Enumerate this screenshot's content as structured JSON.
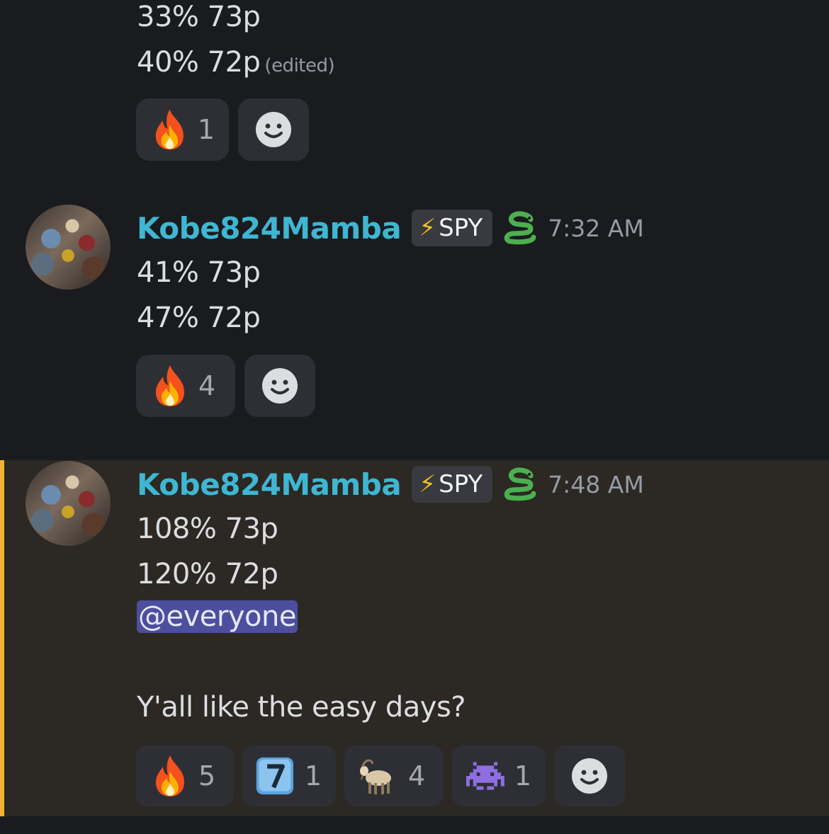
{
  "message1": {
    "lines": [
      "33% 73p",
      "40% 72p"
    ],
    "edited_label": "(edited)",
    "reactions": [
      {
        "emoji": "fire-icon",
        "count": "1"
      }
    ]
  },
  "message2": {
    "username": "Kobe824Mamba",
    "tag": {
      "icon": "lightning-icon",
      "label": "SPY"
    },
    "badge": "snake-icon",
    "timestamp": "7:32 AM",
    "lines": [
      "41% 73p",
      "47% 72p"
    ],
    "reactions": [
      {
        "emoji": "fire-icon",
        "count": "4"
      }
    ]
  },
  "message3": {
    "username": "Kobe824Mamba",
    "tag": {
      "icon": "lightning-icon",
      "label": "SPY"
    },
    "badge": "snake-icon",
    "timestamp": "7:48 AM",
    "lines": [
      "108% 73p",
      "120% 72p"
    ],
    "mention": "@everyone",
    "text": "Y'all like the easy days?",
    "highlight_color": "#f0b232",
    "reactions": [
      {
        "emoji": "fire-icon",
        "count": "5"
      },
      {
        "emoji": "keycap-seven-icon",
        "count": "1"
      },
      {
        "emoji": "goat-icon",
        "count": "4"
      },
      {
        "emoji": "space-invader-icon",
        "count": "1"
      }
    ]
  },
  "colors": {
    "background": "#1a1b1e",
    "username": "#3fb6d2",
    "mention_bg": "#4c4f9e",
    "reaction_bg": "#2e2f35"
  }
}
